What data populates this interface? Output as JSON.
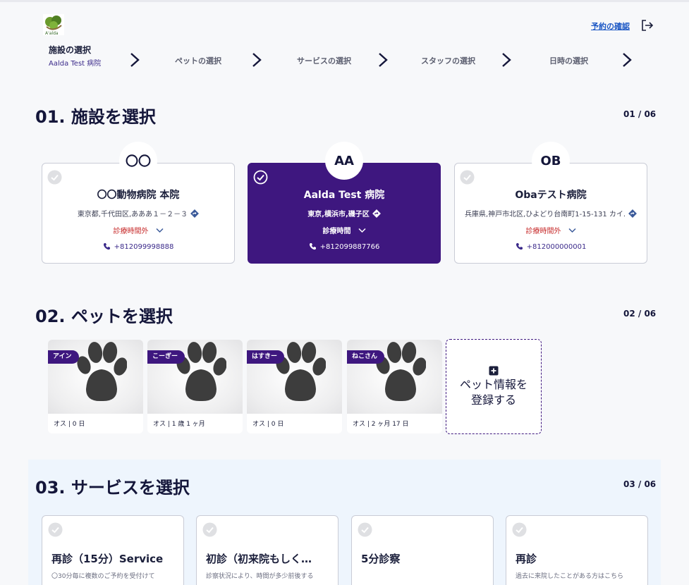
{
  "header": {
    "logo_text": "A'alda",
    "confirm_link": "予約の確認"
  },
  "steps": [
    {
      "label": "施設の選択",
      "sub": "Aalda Test 病院"
    },
    {
      "label": "ペットの選択"
    },
    {
      "label": "サービスの選択"
    },
    {
      "label": "スタッフの選択"
    },
    {
      "label": "日時の選択"
    }
  ],
  "section1": {
    "title": "01. 施設を選択",
    "count": "01 / 06"
  },
  "clinics": [
    {
      "badge": "〇〇",
      "name": "〇〇動物病院 本院",
      "address": "東京都,千代田区,あああ１－２－３",
      "hours": "診療時間外",
      "phone": "+812099998888",
      "selected": false
    },
    {
      "badge": "AA",
      "name": "Aalda Test 病院",
      "address": "東京,横浜市,磯子区",
      "hours": "診療時間",
      "phone": "+812099887766",
      "selected": true
    },
    {
      "badge": "OB",
      "name": "Obaテスト病院",
      "address": "兵庫県,神戸市北区,ひよどり台南町1-15-131 カイ.",
      "hours": "診療時間外",
      "phone": "+812000000001",
      "selected": false
    }
  ],
  "section2": {
    "title": "02. ペットを選択",
    "count": "02 / 06"
  },
  "pets": [
    {
      "name": "アイン",
      "info": "オス | 0 日"
    },
    {
      "name": "こーぎー",
      "info": "オス | 1 歳 1 ヶ月"
    },
    {
      "name": "はすきー",
      "info": "オス | 0 日"
    },
    {
      "name": "ねこさん",
      "info": "オス | 2 ヶ月 17 日"
    }
  ],
  "add_pet": {
    "label": "ペット情報を登録する"
  },
  "section3": {
    "title": "03. サービスを選択",
    "count": "03 / 06"
  },
  "services": [
    {
      "name": "再診（15分）Service",
      "desc": "〇30分毎に複数のご予約を受付けて"
    },
    {
      "name": "初診（初来院もしく…",
      "desc": "診察状況により、時間が多少前後する"
    },
    {
      "name": "5分診察",
      "desc": ""
    },
    {
      "name": "再診",
      "desc": "過去に来院したことがある方はこちら"
    }
  ],
  "colors": {
    "accent": "#3e177f",
    "alert": "#c62828",
    "link": "#1a56c4"
  }
}
